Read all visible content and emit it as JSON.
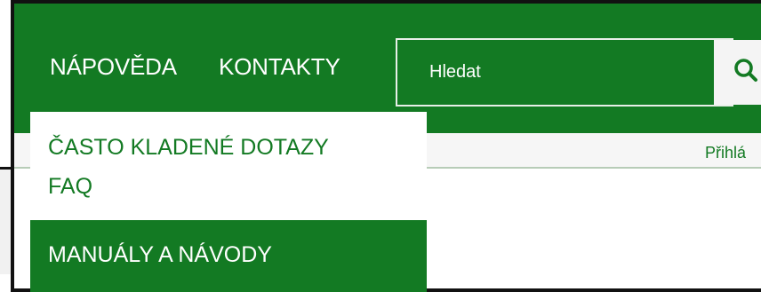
{
  "nav": {
    "help_label": "NÁPOVĚDA",
    "contacts_label": "KONTAKTY"
  },
  "search": {
    "placeholder": "Hledat",
    "icon": "search-icon"
  },
  "subbar": {
    "login_label": "Přihlá"
  },
  "dropdown": {
    "items": [
      {
        "line1": "ČASTO KLADENÉ DOTAZY",
        "line2": "FAQ"
      },
      {
        "label": "MANUÁLY A NÁVODY"
      }
    ]
  },
  "colors": {
    "brand_green": "#137a23",
    "white": "#ffffff",
    "light_gray": "#f4f4f4"
  }
}
